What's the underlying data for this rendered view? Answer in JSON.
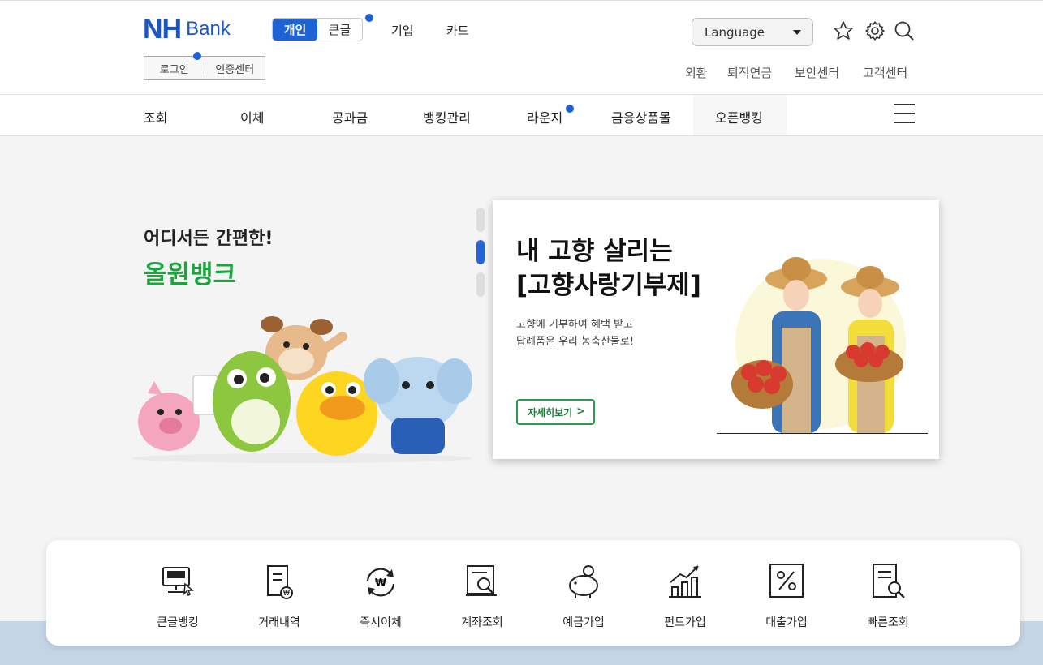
{
  "brand": {
    "logo_main": "NH",
    "logo_sub": "Bank"
  },
  "segment": {
    "personal": "개인",
    "big": "큰글"
  },
  "topnav": {
    "corporate": "기업",
    "card": "카드"
  },
  "login": {
    "login": "로그인",
    "cert": "인증센터"
  },
  "language": {
    "selected": "Language"
  },
  "util": [
    "외환",
    "퇴직연금",
    "보안센터",
    "고객센터"
  ],
  "gnb": [
    "조회",
    "이체",
    "공과금",
    "뱅킹관리",
    "라운지",
    "금융상품몰",
    "오픈뱅킹"
  ],
  "hero": {
    "line1": "어디서든 간편한!",
    "line2": "올원뱅크"
  },
  "card": {
    "title1": "내 고향 살리는",
    "title2": "[고향사랑기부제]",
    "desc1": "고향에 기부하여 혜택 받고",
    "desc2": "답례품은 우리 농축산물로!",
    "button": "자세히보기",
    "button_arrow": ">"
  },
  "quick_menu": [
    "큰글뱅킹",
    "거래내역",
    "즉시이체",
    "계좌조회",
    "예금가입",
    "펀드가입",
    "대출가입",
    "빠른조회"
  ],
  "colors": {
    "primary": "#1d63d6",
    "green": "#1aa53d",
    "band": "#c4d5e6"
  }
}
